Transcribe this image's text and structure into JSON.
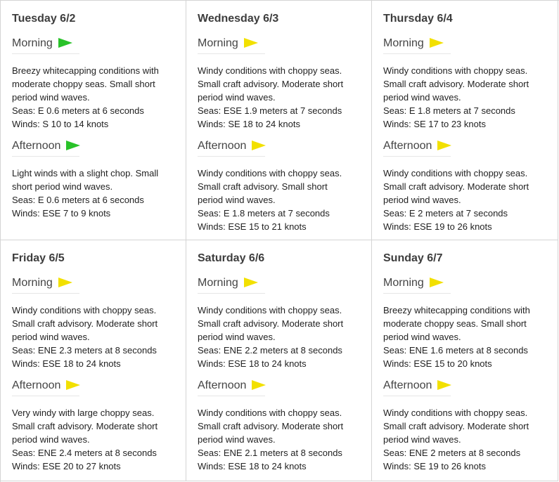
{
  "days": [
    {
      "title": "Tuesday 6/2",
      "morning": {
        "label": "Morning",
        "flag": "green-flag-icon",
        "flag_color": "#29c229",
        "lines": [
          "Breezy whitecapping conditions with",
          "moderate choppy seas. Small short",
          "period wind waves."
        ],
        "seas": "Seas: E 0.6 meters at 6 seconds",
        "winds": "Winds: S 10 to 14 knots"
      },
      "afternoon": {
        "label": "Afternoon",
        "flag": "green-flag-icon",
        "flag_color": "#29c229",
        "lines": [
          "Light winds with a slight chop. Small",
          "short period wind waves."
        ],
        "seas": "Seas: E 0.6 meters at 6 seconds",
        "winds": "Winds: ESE 7 to 9 knots"
      }
    },
    {
      "title": "Wednesday 6/3",
      "morning": {
        "label": "Morning",
        "flag": "yellow-flag-icon",
        "flag_color": "#f2e000",
        "lines": [
          "Windy conditions with choppy seas.",
          "Small craft advisory. Moderate short",
          "period wind waves."
        ],
        "seas": "Seas: ESE 1.9 meters at 7 seconds",
        "winds": "Winds: SE 18 to 24 knots"
      },
      "afternoon": {
        "label": "Afternoon",
        "flag": "yellow-flag-icon",
        "flag_color": "#f2e000",
        "lines": [
          "Windy conditions with choppy seas.",
          "Small craft advisory. Small short",
          "period wind waves."
        ],
        "seas": "Seas: E 1.8 meters at 7 seconds",
        "winds": "Winds: ESE 15 to 21 knots"
      }
    },
    {
      "title": "Thursday 6/4",
      "morning": {
        "label": "Morning",
        "flag": "yellow-flag-icon",
        "flag_color": "#f2e000",
        "lines": [
          "Windy conditions with choppy seas.",
          "Small craft advisory. Moderate short",
          "period wind waves."
        ],
        "seas": "Seas: E 1.8 meters at 7 seconds",
        "winds": "Winds: SE 17 to 23 knots"
      },
      "afternoon": {
        "label": "Afternoon",
        "flag": "yellow-flag-icon",
        "flag_color": "#f2e000",
        "lines": [
          "Windy conditions with choppy seas.",
          "Small craft advisory. Moderate short",
          "period wind waves."
        ],
        "seas": "Seas: E 2 meters at 7 seconds",
        "winds": "Winds: ESE 19 to 26 knots"
      }
    },
    {
      "title": "Friday 6/5",
      "morning": {
        "label": "Morning",
        "flag": "yellow-flag-icon",
        "flag_color": "#f2e000",
        "lines": [
          "Windy conditions with choppy seas.",
          "Small craft advisory. Moderate short",
          "period wind waves."
        ],
        "seas": "Seas: ENE 2.3 meters at 8 seconds",
        "winds": "Winds: ESE 18 to 24 knots"
      },
      "afternoon": {
        "label": "Afternoon",
        "flag": "yellow-flag-icon",
        "flag_color": "#f2e000",
        "lines": [
          "Very windy with large choppy seas.",
          "Small craft advisory. Moderate short",
          "period wind waves."
        ],
        "seas": "Seas: ENE 2.4 meters at 8 seconds",
        "winds": "Winds: ESE 20 to 27 knots"
      }
    },
    {
      "title": "Saturday 6/6",
      "morning": {
        "label": "Morning",
        "flag": "yellow-flag-icon",
        "flag_color": "#f2e000",
        "lines": [
          "Windy conditions with choppy seas.",
          "Small craft advisory. Moderate short",
          "period wind waves."
        ],
        "seas": "Seas: ENE 2.2 meters at 8 seconds",
        "winds": "Winds: ESE 18 to 24 knots"
      },
      "afternoon": {
        "label": "Afternoon",
        "flag": "yellow-flag-icon",
        "flag_color": "#f2e000",
        "lines": [
          "Windy conditions with choppy seas.",
          "Small craft advisory. Moderate short",
          "period wind waves."
        ],
        "seas": "Seas: ENE 2.1 meters at 8 seconds",
        "winds": "Winds: ESE 18 to 24 knots"
      }
    },
    {
      "title": "Sunday 6/7",
      "morning": {
        "label": "Morning",
        "flag": "yellow-flag-icon",
        "flag_color": "#f2e000",
        "lines": [
          "Breezy whitecapping conditions with",
          "moderate choppy seas. Small short",
          "period wind waves."
        ],
        "seas": "Seas: ENE 1.6 meters at 8 seconds",
        "winds": "Winds: ESE 15 to 20 knots"
      },
      "afternoon": {
        "label": "Afternoon",
        "flag": "yellow-flag-icon",
        "flag_color": "#f2e000",
        "lines": [
          "Windy conditions with choppy seas.",
          "Small craft advisory. Moderate short",
          "period wind waves."
        ],
        "seas": "Seas: ENE 2 meters at 8 seconds",
        "winds": "Winds: SE 19 to 26 knots"
      }
    }
  ]
}
